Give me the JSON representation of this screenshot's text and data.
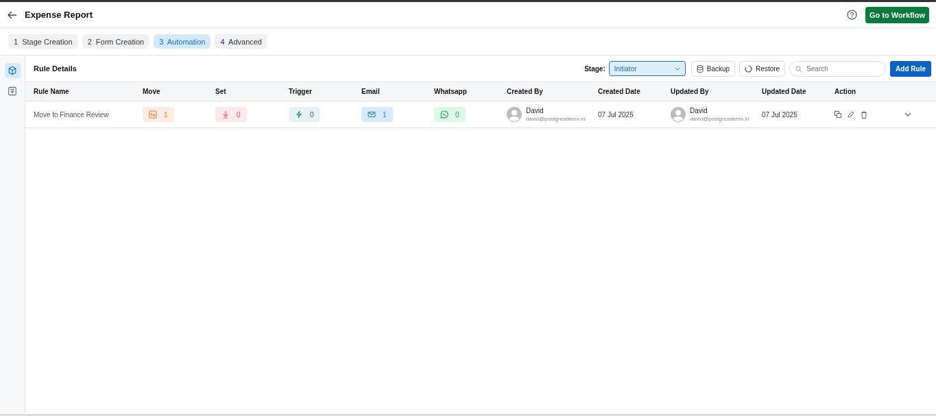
{
  "header": {
    "title": "Expense Report",
    "button": "Go to Workflow"
  },
  "tabs": [
    {
      "number": "1",
      "label": "Stage Creation",
      "selected": false
    },
    {
      "number": "2",
      "label": "Form Creation",
      "selected": false
    },
    {
      "number": "3",
      "label": "Automation",
      "selected": true
    },
    {
      "number": "4",
      "label": "Advanced",
      "selected": false
    }
  ],
  "sidebar": {
    "items": [
      {
        "kind": "cube",
        "selected": true
      },
      {
        "kind": "form",
        "selected": false
      }
    ]
  },
  "toolbar": {
    "title": "Rule Details",
    "stage_label": "Stage:",
    "stage_value": "Initiator",
    "backup": "Backup",
    "restore": "Restore",
    "search": {
      "placeholder": "Search"
    },
    "add_button": "Add Rule"
  },
  "table": {
    "columns": [
      "Rule Name",
      "Move",
      "Set",
      "Trigger",
      "Email",
      "Whatsapp",
      "Created By",
      "Created Date",
      "Updated By",
      "Updated Date",
      "Action"
    ],
    "rows": [
      {
        "name": "Move to Finance Review",
        "counts": [
          {
            "kind": "move",
            "value": "1"
          },
          {
            "kind": "set",
            "value": "0"
          },
          {
            "kind": "trigger",
            "value": "0"
          },
          {
            "kind": "email",
            "value": "1"
          },
          {
            "kind": "whatsapp",
            "value": "0"
          }
        ],
        "created_by": {
          "name": "David",
          "email": "david@postgresdemo.in"
        },
        "created_date": "07 Jul 2025",
        "updated_by": {
          "name": "David",
          "email": "david@postgresdemo.in"
        },
        "updated_date": "07 Jul 2025"
      }
    ]
  }
}
